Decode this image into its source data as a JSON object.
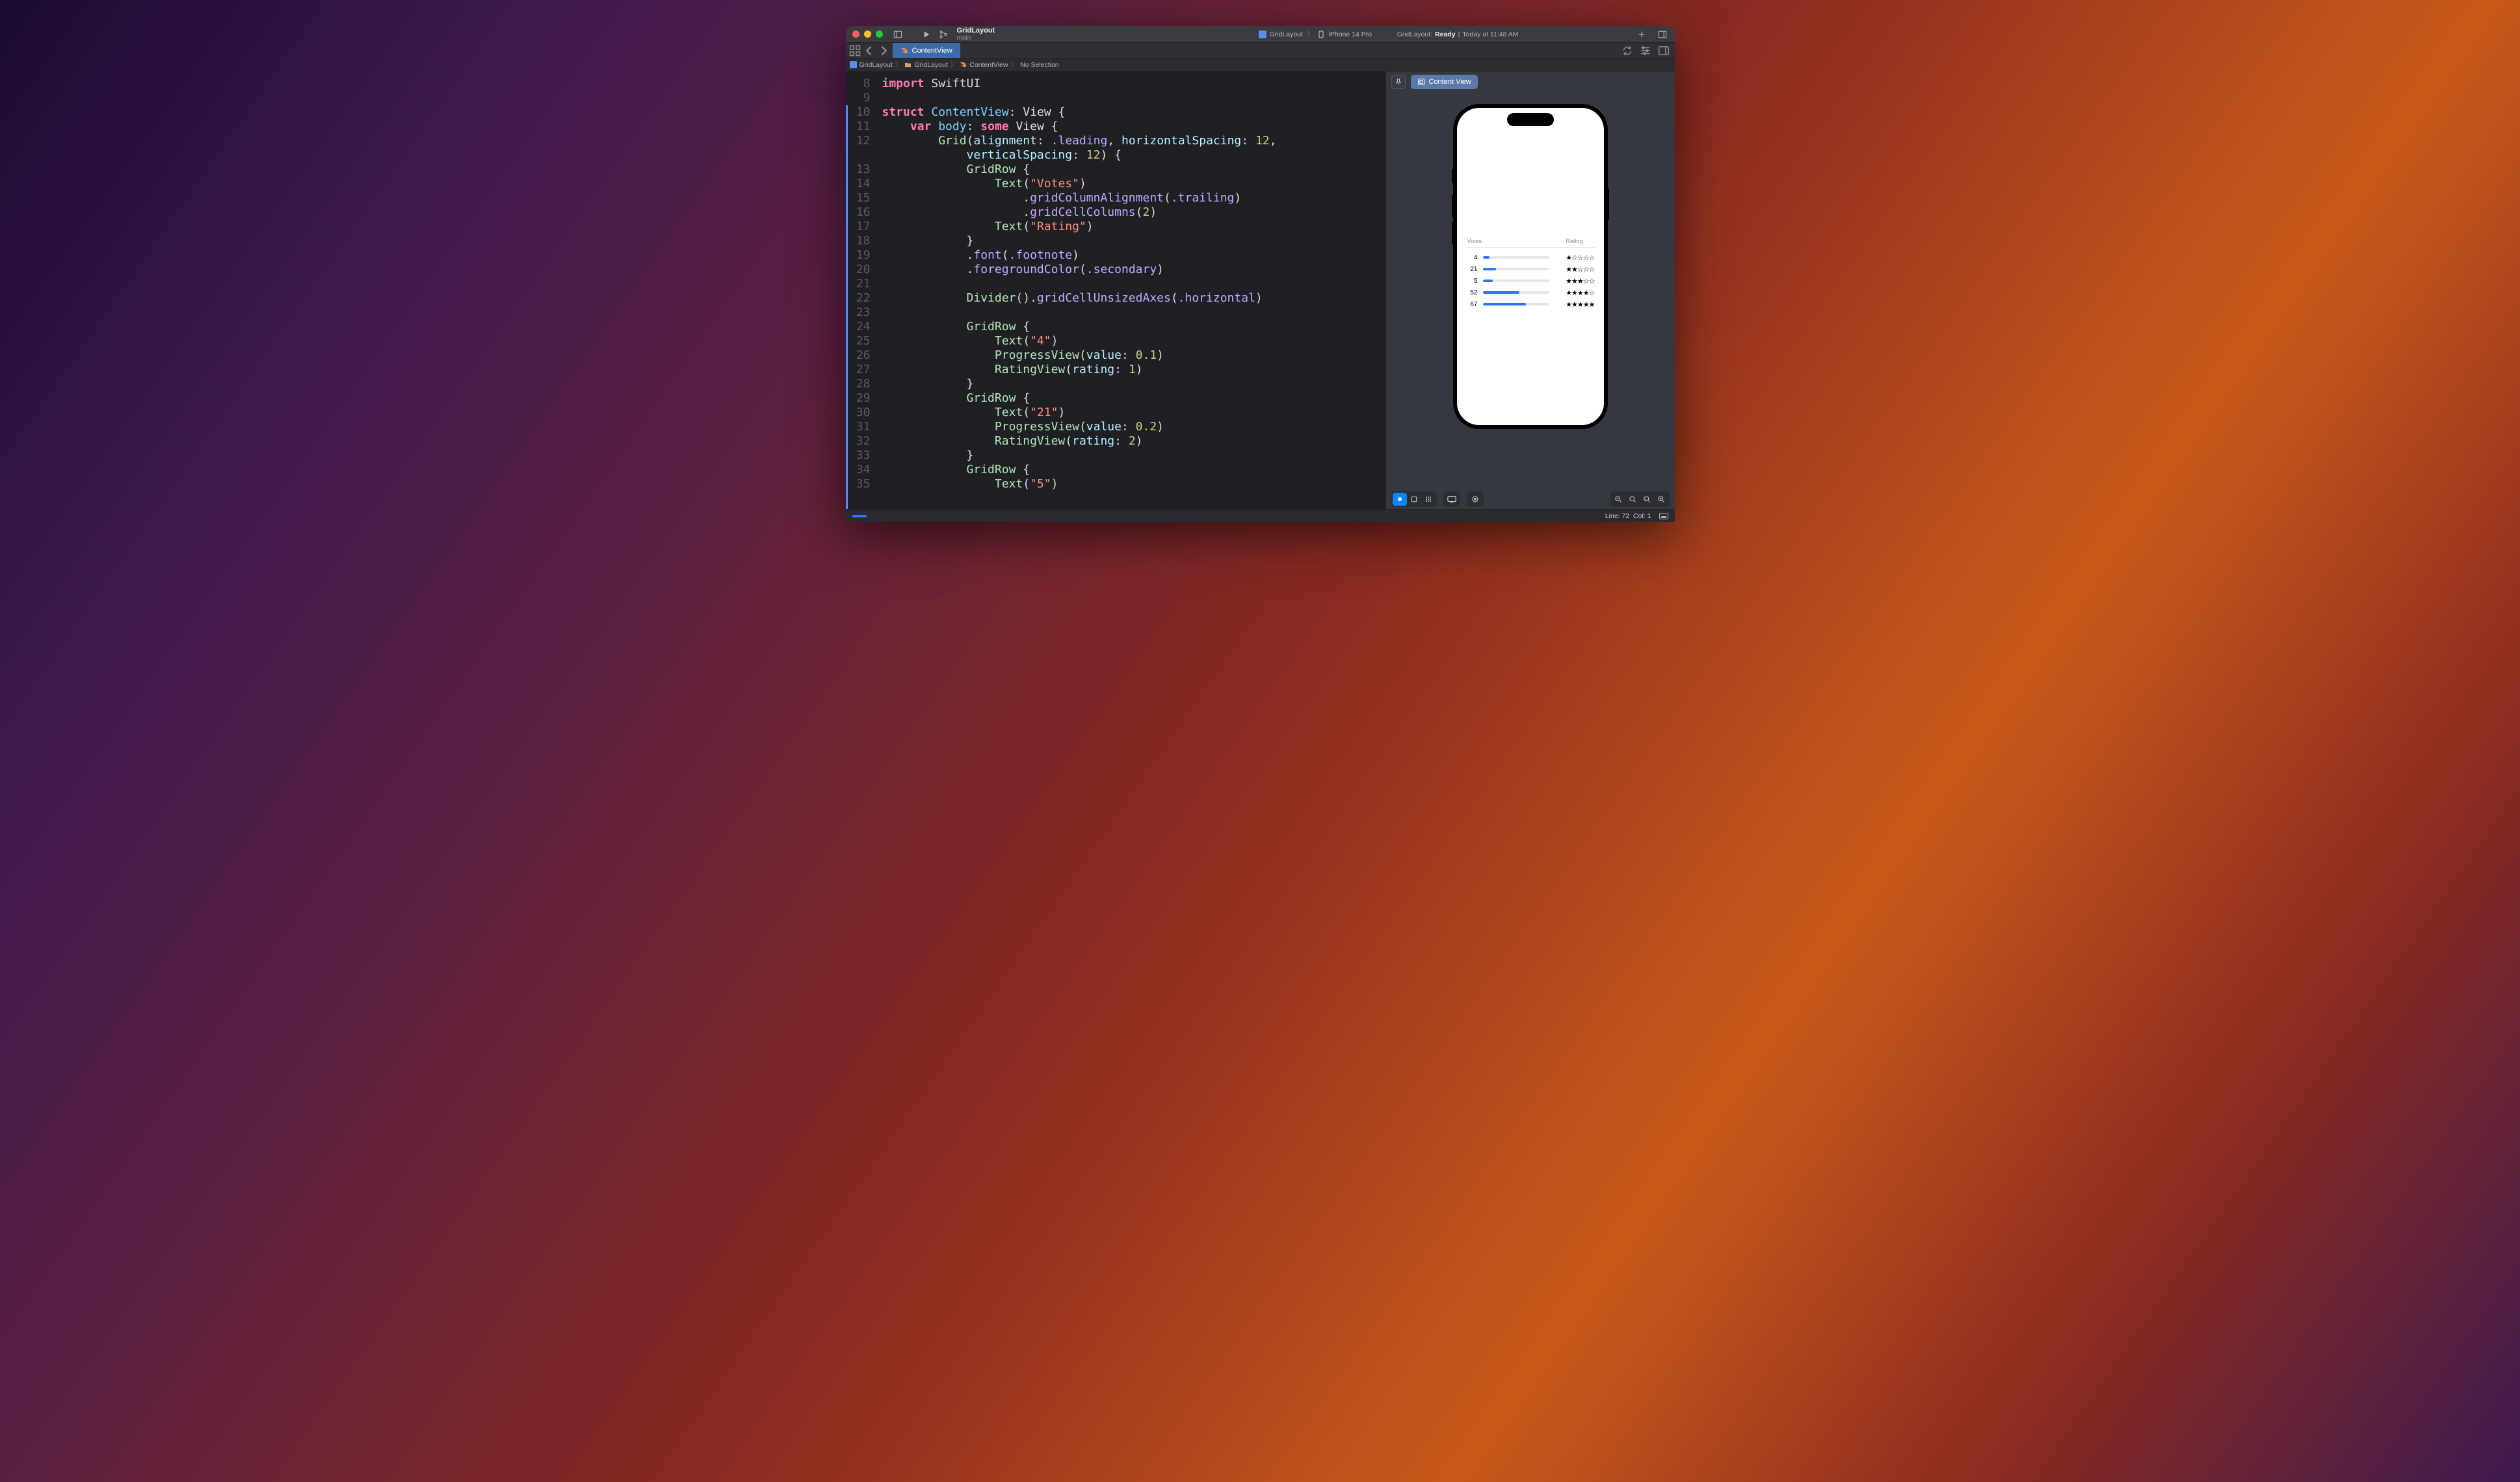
{
  "window": {
    "scheme_name": "GridLayout",
    "scheme_branch": "main"
  },
  "run_dest": {
    "project_icon": "app-icon",
    "project": "GridLayout",
    "device_icon": "iphone-icon",
    "device": "iPhone 14 Pro"
  },
  "activity": {
    "prefix": "GridLayout:",
    "state": "Ready",
    "sep": "|",
    "time": "Today at 11:48 AM"
  },
  "tabs": {
    "file": "ContentView"
  },
  "crumb": {
    "c0": "GridLayout",
    "c1": "GridLayout",
    "c2": "ContentView",
    "c3": "No Selection"
  },
  "code": {
    "lines": [
      "8",
      "9",
      "10",
      "11",
      "12",
      "",
      "13",
      "14",
      "15",
      "16",
      "17",
      "18",
      "19",
      "20",
      "21",
      "22",
      "23",
      "24",
      "25",
      "26",
      "27",
      "28",
      "29",
      "30",
      "31",
      "32",
      "33",
      "34",
      "35"
    ],
    "l8": {
      "import": "import",
      "mod": "SwiftUI"
    },
    "l10": {
      "struct": "struct",
      "name": "ContentView",
      "colon": ":",
      "view": "View",
      "brace": "{"
    },
    "l11": {
      "var": "var",
      "body": "body",
      "colon": ":",
      "some": "some",
      "view": "View",
      "brace": "{"
    },
    "l12": {
      "grid": "Grid",
      "open": "(",
      "p1": "alignment",
      "c": ":",
      "v1": ".leading",
      "comma": ",",
      "p2": "horizontalSpacing",
      "v2": "12",
      "comma2": ","
    },
    "l12b": {
      "p3": "verticalSpacing",
      "c": ":",
      "v3": "12",
      "close": ")",
      "brace": "{"
    },
    "l13": {
      "gr": "GridRow",
      "brace": "{"
    },
    "l14": {
      "text": "Text",
      "open": "(",
      "s": "\"Votes\"",
      "close": ")"
    },
    "l15": {
      "dot": ".",
      "m": "gridColumnAlignment",
      "open": "(",
      "v": ".trailing",
      "close": ")"
    },
    "l16": {
      "dot": ".",
      "m": "gridCellColumns",
      "open": "(",
      "v": "2",
      "close": ")"
    },
    "l17": {
      "text": "Text",
      "open": "(",
      "s": "\"Rating\"",
      "close": ")"
    },
    "l18": {
      "brace": "}"
    },
    "l19": {
      "dot": ".",
      "m": "font",
      "open": "(",
      "v": ".footnote",
      "close": ")"
    },
    "l20": {
      "dot": ".",
      "m": "foregroundColor",
      "open": "(",
      "v": ".secondary",
      "close": ")"
    },
    "l22": {
      "div": "Divider",
      "p": "().",
      "m": "gridCellUnsizedAxes",
      "open": "(",
      "v": ".horizontal",
      "close": ")"
    },
    "l24": {
      "gr": "GridRow",
      "brace": "{"
    },
    "l25": {
      "text": "Text",
      "open": "(",
      "s": "\"4\"",
      "close": ")"
    },
    "l26": {
      "pv": "ProgressView",
      "open": "(",
      "p": "value",
      "c": ":",
      "v": "0.1",
      "close": ")"
    },
    "l27": {
      "rv": "RatingView",
      "open": "(",
      "p": "rating",
      "c": ":",
      "v": "1",
      "close": ")"
    },
    "l28": {
      "brace": "}"
    },
    "l29": {
      "gr": "GridRow",
      "brace": "{"
    },
    "l30": {
      "text": "Text",
      "open": "(",
      "s": "\"21\"",
      "close": ")"
    },
    "l31": {
      "pv": "ProgressView",
      "open": "(",
      "p": "value",
      "c": ":",
      "v": "0.2",
      "close": ")"
    },
    "l32": {
      "rv": "RatingView",
      "open": "(",
      "p": "rating",
      "c": ":",
      "v": "2",
      "close": ")"
    },
    "l33": {
      "brace": "}"
    },
    "l34": {
      "gr": "GridRow",
      "brace": "{"
    },
    "l35": {
      "text": "Text",
      "open": "(",
      "s": "\"5\"",
      "close": ")"
    }
  },
  "canvas": {
    "chip": "Content View"
  },
  "preview": {
    "h_votes": "Votes",
    "h_rating": "Rating",
    "rows": [
      {
        "votes": "4",
        "progress": 0.1,
        "rating": 1
      },
      {
        "votes": "21",
        "progress": 0.2,
        "rating": 2
      },
      {
        "votes": "5",
        "progress": 0.15,
        "rating": 3
      },
      {
        "votes": "52",
        "progress": 0.55,
        "rating": 4
      },
      {
        "votes": "67",
        "progress": 0.65,
        "rating": 5
      }
    ]
  },
  "statusbar": {
    "line_label": "Line:",
    "line": "72",
    "col_label": "Col:",
    "col": "1"
  }
}
